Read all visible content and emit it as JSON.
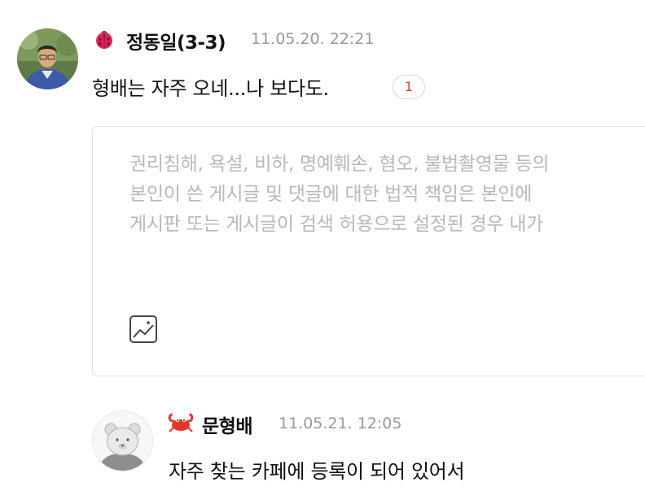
{
  "comments": [
    {
      "author": "정동일(3-3)",
      "date": "11.05.20. 22:21",
      "text": "형배는 자주 오네...나 보다도.",
      "reply_count": "1",
      "level_icon": "ladybug-icon",
      "avatar": "profile-photo"
    },
    {
      "author": "문형배",
      "date": "11.05.21. 12:05",
      "text": "자주 찾는 카페에 등록이 되어 있어서",
      "level_icon": "crab-icon",
      "avatar": "default-bear-avatar"
    }
  ],
  "reply_box": {
    "placeholder_lines": [
      "권리침해, 욕설, 비하, 명예훼손, 혐오, 불법촬영물 등의",
      "본인이 쓴 게시글 및 댓글에 대한 법적 책임은 본인에",
      "게시판 또는 게시글이 검색 허용으로 설정된 경우 내가"
    ],
    "photo_icon": "image-icon"
  },
  "colors": {
    "reply_count": "#e5393a",
    "date": "#999999",
    "placeholder": "#b8b8b8",
    "border": "#e2e2e2"
  }
}
